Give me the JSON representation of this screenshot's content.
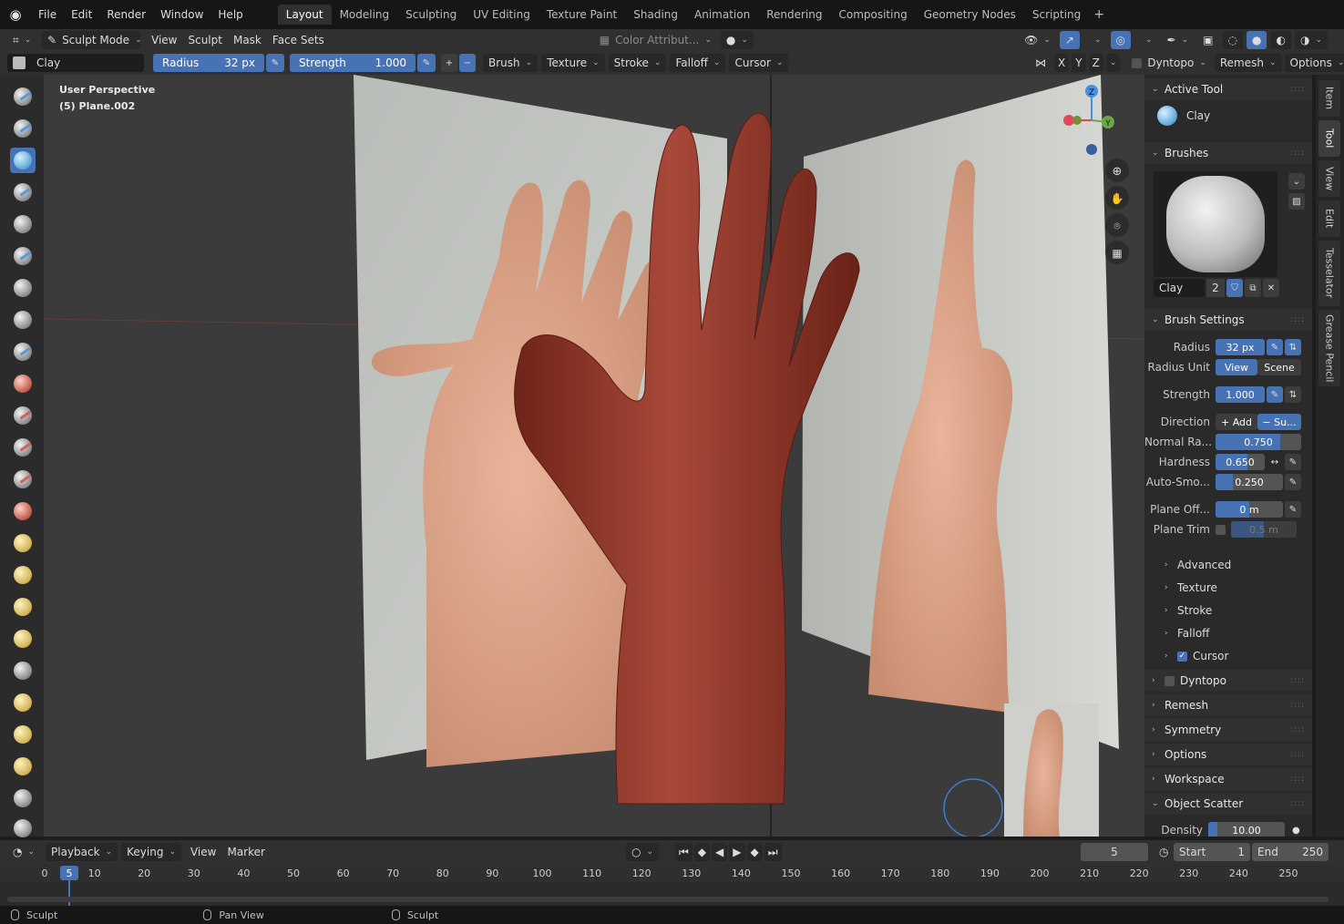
{
  "menubar": {
    "items": [
      "File",
      "Edit",
      "Render",
      "Window",
      "Help"
    ],
    "workspaces": [
      "Layout",
      "Modeling",
      "Sculpting",
      "UV Editing",
      "Texture Paint",
      "Shading",
      "Animation",
      "Rendering",
      "Compositing",
      "Geometry Nodes",
      "Scripting"
    ],
    "active_workspace": "Layout"
  },
  "header": {
    "mode": "Sculpt Mode",
    "menus": [
      "View",
      "Sculpt",
      "Mask",
      "Face Sets"
    ],
    "color_attribute": "Color Attribut...",
    "brush_name": "Clay",
    "radius_label": "Radius",
    "radius_value": "32 px",
    "strength_label": "Strength",
    "strength_value": "1.000",
    "dropdowns": [
      "Brush",
      "Texture",
      "Stroke",
      "Falloff",
      "Cursor"
    ],
    "axis_x": "X",
    "axis_y": "Y",
    "axis_z": "Z",
    "dyntopo": "Dyntopo",
    "remesh": "Remesh",
    "options": "Options"
  },
  "viewport": {
    "perspective": "User Perspective",
    "object": "(5) Plane.002"
  },
  "npanel": {
    "active_tool_title": "Active Tool",
    "active_tool_name": "Clay",
    "brushes_title": "Brushes",
    "brush_name": "Clay",
    "brush_users": "2",
    "brush_settings_title": "Brush Settings",
    "radius_label": "Radius",
    "radius_value": "32 px",
    "radius_unit_label": "Radius Unit",
    "radius_unit_view": "View",
    "radius_unit_scene": "Scene",
    "strength_label": "Strength",
    "strength_value": "1.000",
    "direction_label": "Direction",
    "direction_add": "+ Add",
    "direction_sub": "− Su...",
    "normal_radius_label": "Normal Ra...",
    "normal_radius_value": "0.750",
    "normal_radius_fraction": 0.75,
    "hardness_label": "Hardness",
    "hardness_value": "0.650",
    "hardness_fraction": 0.65,
    "autosmooth_label": "Auto-Smo...",
    "autosmooth_value": "0.250",
    "autosmooth_fraction": 0.25,
    "plane_offset_label": "Plane Off...",
    "plane_offset_value": "0 m",
    "plane_trim_label": "Plane Trim",
    "plane_trim_value": "0.5 m",
    "subpanels": [
      "Advanced",
      "Texture",
      "Stroke",
      "Falloff",
      "Cursor"
    ],
    "panels": [
      "Dyntopo",
      "Remesh",
      "Symmetry",
      "Options",
      "Workspace"
    ],
    "object_scatter_title": "Object Scatter",
    "density_label": "Density",
    "density_value": "10.00"
  },
  "sidetabs": [
    "Item",
    "Tool",
    "View",
    "Edit",
    "Tesselator",
    "Grease Pencil"
  ],
  "timeline": {
    "playback": "Playback",
    "keying": "Keying",
    "view": "View",
    "marker": "Marker",
    "current_frame": "5",
    "start_label": "Start",
    "start_value": "1",
    "end_label": "End",
    "end_value": "250",
    "ruler": [
      "0",
      "10",
      "20",
      "30",
      "40",
      "50",
      "60",
      "70",
      "80",
      "90",
      "100",
      "110",
      "120",
      "130",
      "140",
      "150",
      "160",
      "170",
      "180",
      "190",
      "200",
      "210",
      "220",
      "230",
      "240",
      "250"
    ]
  },
  "statusbar": {
    "items": [
      "Sculpt",
      "Pan View",
      "Sculpt"
    ]
  }
}
